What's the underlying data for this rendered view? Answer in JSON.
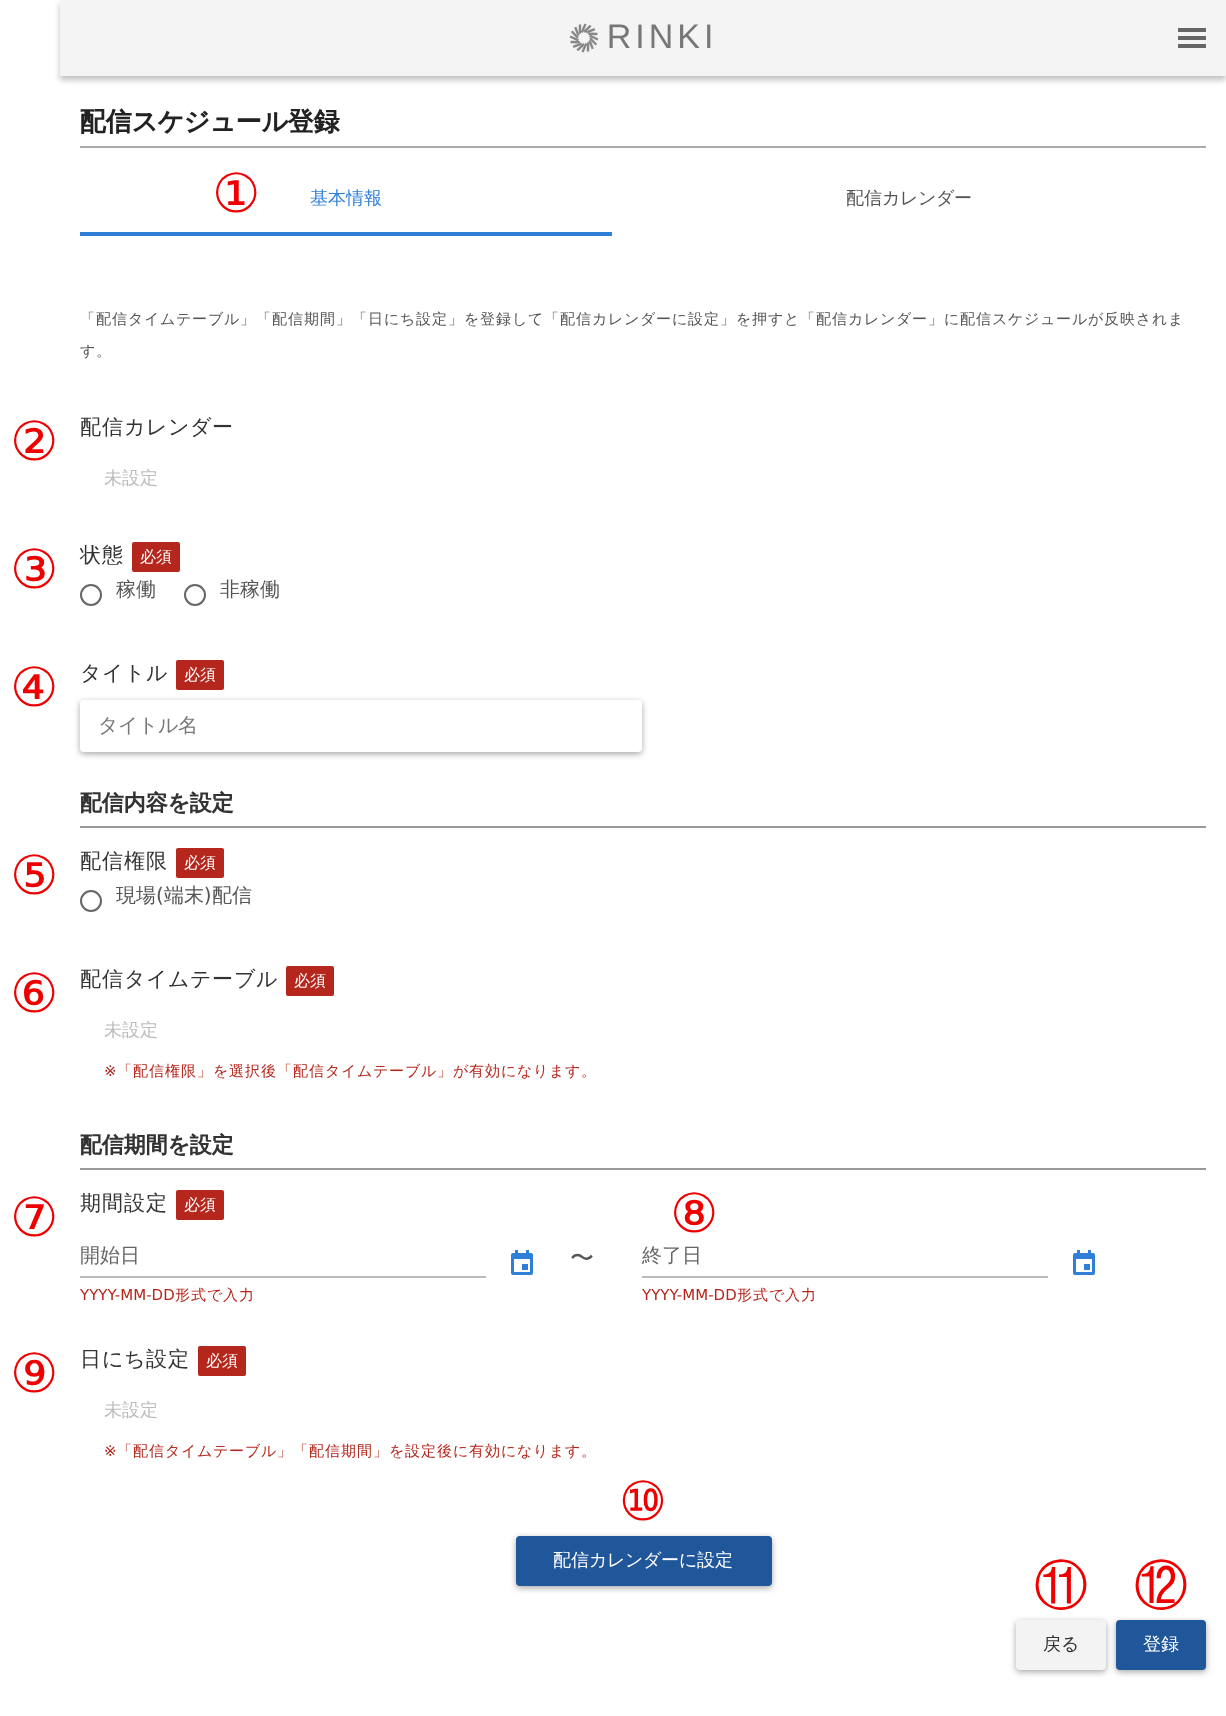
{
  "header": {
    "logo": "RINKI"
  },
  "page_title": "配信スケジュール登録",
  "tabs": [
    {
      "label": "基本情報",
      "selected": true,
      "callout": "①"
    },
    {
      "label": "配信カレンダー",
      "selected": false
    }
  ],
  "description": "「配信タイムテーブル」「配信期間」「日にち設定」を登録して「配信カレンダーに設定」を押すと「配信カレンダー」に配信スケジュールが反映されます。",
  "items": [
    {
      "kind": "display",
      "label": "配信カレンダー",
      "callout": "②",
      "value": "未設定"
    },
    {
      "kind": "radio",
      "label": "状態",
      "badge": "必須",
      "callout": "③",
      "options": [
        {
          "label": "稼働",
          "selected": false
        },
        {
          "label": "非稼働",
          "selected": false
        }
      ]
    },
    {
      "kind": "text",
      "label": "タイトル",
      "badge": "必須",
      "callout": "④",
      "placeholder": "タイトル名"
    },
    {
      "kind": "heading",
      "label": "配信内容を設定"
    },
    {
      "kind": "radio",
      "label": "配信権限",
      "badge": "必須",
      "callout": "⑤",
      "options": [
        {
          "label": "現場(端末)配信",
          "selected": false
        }
      ]
    },
    {
      "kind": "display",
      "label": "配信タイムテーブル",
      "badge": "必須",
      "callout": "⑥",
      "value": "未設定",
      "note": "※「配信権限」を選択後「配信タイムテーブル」が有効になります。"
    },
    {
      "kind": "heading",
      "label": "配信期間を設定"
    },
    {
      "kind": "date_range",
      "label": "期間設定",
      "badge": "必須",
      "callout": "⑦",
      "separator": "〜",
      "start": {
        "placeholder": "開始日",
        "hint": "YYYY-MM-DD形式で入力"
      },
      "end": {
        "placeholder": "終了日",
        "hint": "YYYY-MM-DD形式で入力",
        "callout": "⑧"
      }
    },
    {
      "kind": "display",
      "label": "日にち設定",
      "badge": "必須",
      "callout": "⑨",
      "value": "未設定",
      "note": "※「配信タイムテーブル」「配信期間」を設定後に有効になります。"
    }
  ],
  "set_button": {
    "label": "配信カレンダーに設定",
    "callout": "⑩"
  },
  "footer_buttons": [
    {
      "label": "戻る",
      "kind": "secondary",
      "callout": "⑪"
    },
    {
      "label": "登録",
      "kind": "primary",
      "callout": "⑫"
    }
  ]
}
